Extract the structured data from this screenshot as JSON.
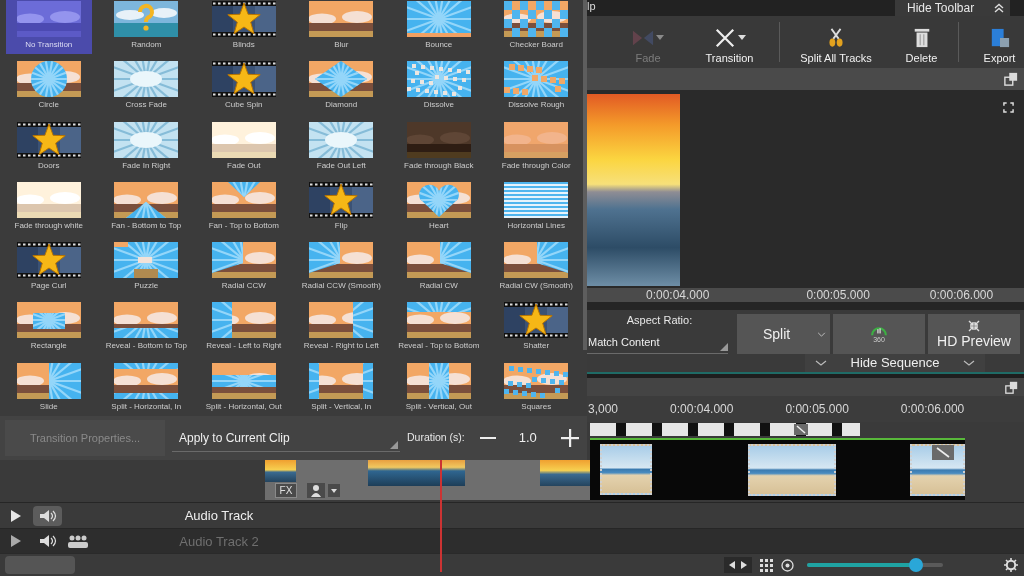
{
  "transitions": [
    {
      "label": "No Transition",
      "kind": "none",
      "selected": true
    },
    {
      "label": "Random",
      "kind": "question",
      "selected": false
    },
    {
      "label": "Blinds",
      "kind": "star",
      "selected": false
    },
    {
      "label": "Blur",
      "kind": "scene",
      "selected": false
    },
    {
      "label": "Bounce",
      "kind": "bounce",
      "selected": false
    },
    {
      "label": "Checker Board",
      "kind": "checker",
      "selected": false
    },
    {
      "label": "Circle",
      "kind": "circle",
      "selected": false
    },
    {
      "label": "Cross Fade",
      "kind": "haze",
      "selected": false
    },
    {
      "label": "Cube Spin",
      "kind": "star",
      "selected": false
    },
    {
      "label": "Diamond",
      "kind": "diamond",
      "selected": false
    },
    {
      "label": "Dissolve",
      "kind": "dissolve",
      "selected": false
    },
    {
      "label": "Dissolve Rough",
      "kind": "rough",
      "selected": false
    },
    {
      "label": "Doors",
      "kind": "star",
      "selected": false
    },
    {
      "label": "Fade In Right",
      "kind": "haze",
      "selected": false
    },
    {
      "label": "Fade Out",
      "kind": "pale",
      "selected": false
    },
    {
      "label": "Fade Out Left",
      "kind": "haze",
      "selected": false
    },
    {
      "label": "Fade through Black",
      "kind": "dark",
      "selected": false
    },
    {
      "label": "Fade through Color",
      "kind": "tint",
      "selected": false
    },
    {
      "label": "Fade through white",
      "kind": "pale",
      "selected": false
    },
    {
      "label": "Fan - Bottom to Top",
      "kind": "fanup",
      "selected": false
    },
    {
      "label": "Fan - Top to Bottom",
      "kind": "fandown",
      "selected": false
    },
    {
      "label": "Flip",
      "kind": "star",
      "selected": false
    },
    {
      "label": "Heart",
      "kind": "heart",
      "selected": false
    },
    {
      "label": "Horizontal Lines",
      "kind": "lines",
      "selected": false
    },
    {
      "label": "Page Curl",
      "kind": "star",
      "selected": false
    },
    {
      "label": "Puzzle",
      "kind": "puzzle",
      "selected": false
    },
    {
      "label": "Radial CCW",
      "kind": "wedgeleft",
      "selected": false
    },
    {
      "label": "Radial CCW (Smooth)",
      "kind": "wedgeleft",
      "selected": false
    },
    {
      "label": "Radial CW",
      "kind": "wedgeright",
      "selected": false
    },
    {
      "label": "Radial CW (Smooth)",
      "kind": "wedgeright",
      "selected": false
    },
    {
      "label": "Rectangle",
      "kind": "rectangle",
      "selected": false
    },
    {
      "label": "Reveal - Bottom to Top",
      "kind": "bandbottom",
      "selected": false
    },
    {
      "label": "Reveal - Left to Right",
      "kind": "bandleft",
      "selected": false
    },
    {
      "label": "Reveal - Right to Left",
      "kind": "bandright",
      "selected": false
    },
    {
      "label": "Reveal - Top to Bottom",
      "kind": "bandtop",
      "selected": false
    },
    {
      "label": "Shatter",
      "kind": "star",
      "selected": false
    },
    {
      "label": "Slide",
      "kind": "slide",
      "selected": false
    },
    {
      "label": "Split - Horizontal, In",
      "kind": "edgesh",
      "selected": false
    },
    {
      "label": "Split - Horizontal, Out",
      "kind": "middleh",
      "selected": false
    },
    {
      "label": "Split - Vertical, In",
      "kind": "edgesv",
      "selected": false
    },
    {
      "label": "Split - Vertical, Out",
      "kind": "middlev",
      "selected": false
    },
    {
      "label": "Squares",
      "kind": "squares",
      "selected": false
    }
  ],
  "top_bar": {
    "menu_fragment": "lp",
    "hide_toolbar": "Hide Toolbar"
  },
  "toolbar": [
    {
      "label": "Fade",
      "kind": "fade",
      "disabled": true,
      "dropdown": true,
      "separator": false
    },
    {
      "label": "Transition",
      "kind": "transition",
      "disabled": false,
      "dropdown": true,
      "separator": true
    },
    {
      "label": "Split All Tracks",
      "kind": "split",
      "disabled": false,
      "dropdown": false,
      "separator": false
    },
    {
      "label": "Delete",
      "kind": "delete",
      "disabled": false,
      "dropdown": false,
      "separator": true
    },
    {
      "label": "Export",
      "kind": "export",
      "disabled": false,
      "dropdown": false,
      "separator": false
    }
  ],
  "preview_ruler": [
    "0:00:04.000",
    "0:00:05.000",
    "0:00:06.000"
  ],
  "controls": {
    "aspect_ratio_label": "Aspect Ratio:",
    "aspect_ratio": "Match Content",
    "split": "Split",
    "quality": "360",
    "hd_preview": "HD Preview",
    "hide_sequence": "Hide Sequence"
  },
  "timeline_ruler": [
    "3,000",
    "0:00:04.000",
    "0:00:05.000",
    "0:00:06.000"
  ],
  "transition_bar": {
    "properties": {
      "label": "Transition Properties...",
      "disabled": true
    },
    "apply_to": "Apply to Current Clip",
    "duration_label": "Duration (s):",
    "duration": "1.0"
  },
  "video_track": {
    "fx": "FX"
  },
  "audio_tracks": [
    {
      "label": "Audio Track",
      "disabled": false,
      "group_icon": false
    },
    {
      "label": "Audio Track 2",
      "disabled": true,
      "group_icon": true
    }
  ],
  "zoom_slider": {
    "level": 0.8
  }
}
